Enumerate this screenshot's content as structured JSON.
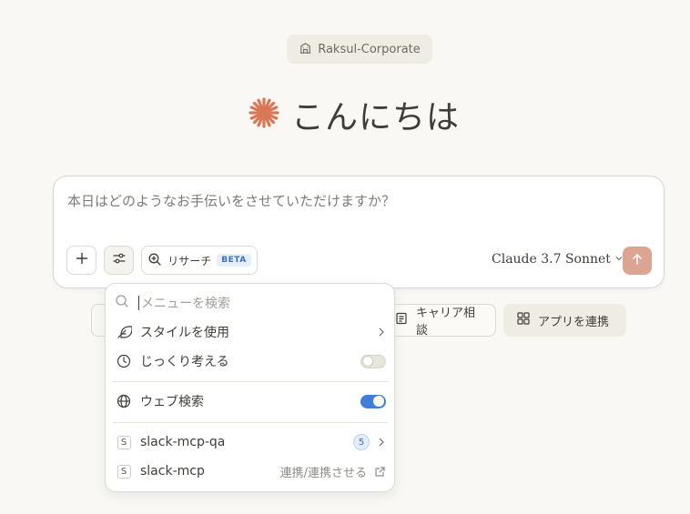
{
  "org": {
    "name": "Raksul-Corporate",
    "icon": "building-icon"
  },
  "greeting": {
    "text": "こんにちは",
    "logo": "claude-spark-logo",
    "logo_color": "#d97757"
  },
  "composer": {
    "placeholder": "本日はどのようなお手伝いをさせていただけますか？",
    "research_label": "リサーチ",
    "beta_label": "BETA",
    "model": "Claude 3.7 Sonnet",
    "send_color": "#dba591"
  },
  "chips": {
    "career": "キャリア相談",
    "apps": "アプリを連携"
  },
  "menu": {
    "search_placeholder": "メニューを検索",
    "items": [
      {
        "label": "スタイルを使用",
        "icon": "feather-icon"
      },
      {
        "label": "じっくり考える",
        "icon": "clock-icon",
        "toggle": false
      },
      {
        "label": "ウェブ検索",
        "icon": "globe-icon",
        "toggle": true
      },
      {
        "label": "slack-mcp-qa",
        "icon": "s-badge",
        "badge_letter": "S",
        "count": "5"
      },
      {
        "label": "slack-mcp",
        "icon": "s-badge",
        "badge_letter": "S",
        "action": "連携/連携させる"
      }
    ]
  },
  "colors": {
    "background": "#f9f8f4",
    "toggle_on": "#3f80d6",
    "accent": "#d97757"
  }
}
